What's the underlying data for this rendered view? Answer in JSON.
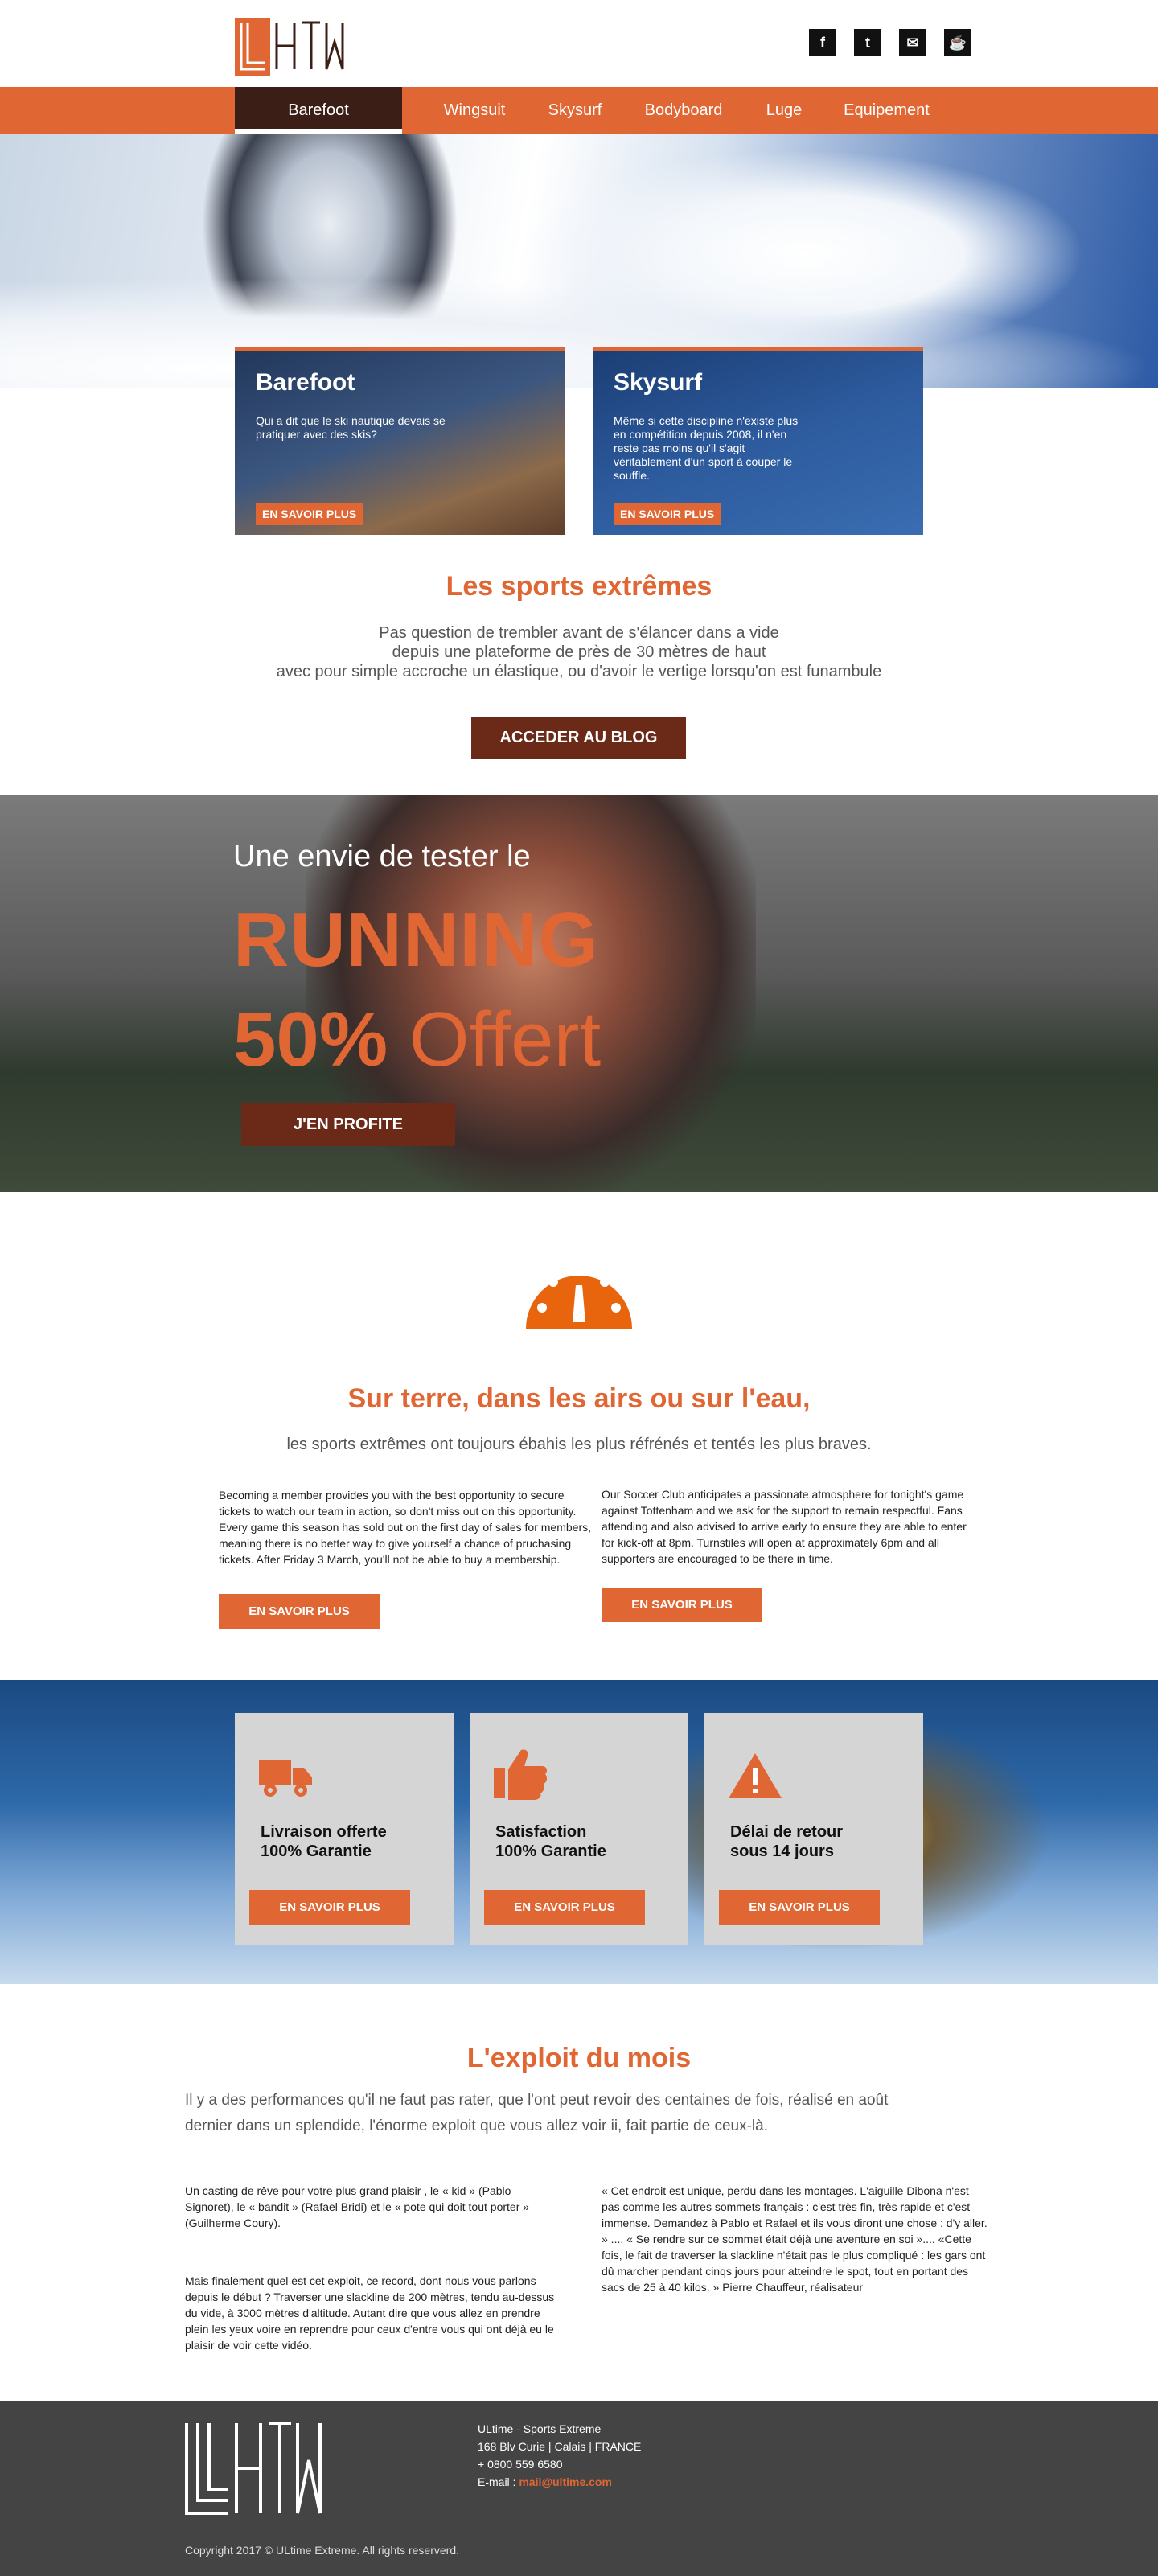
{
  "header": {
    "logo_label": "ULtime",
    "social": [
      {
        "icon": "facebook-icon",
        "glyph": "f"
      },
      {
        "icon": "twitter-icon",
        "glyph": "t"
      },
      {
        "icon": "mail-icon",
        "glyph": "✉"
      },
      {
        "icon": "coffee-icon",
        "glyph": "☕"
      }
    ]
  },
  "nav": {
    "items": [
      "Barefoot",
      "Wingsuit",
      "Skysurf",
      "Bodyboard",
      "Luge",
      "Equipement"
    ],
    "active": "Barefoot"
  },
  "cards": [
    {
      "title": "Barefoot",
      "text": "Qui a dit que le ski nautique devais se pratiquer avec des skis?",
      "button": "EN SAVOIR PLUS"
    },
    {
      "title": "Skysurf",
      "text": "Même si cette discipline n'existe plus en compétition depuis 2008, il n'en reste pas moins qu'il s'agit véritablement d'un sport à couper le souffle.",
      "button": "EN SAVOIR PLUS"
    }
  ],
  "sports": {
    "title": "Les sports extrêmes",
    "line1": "Pas question de trembler avant de s'élancer dans a vide",
    "line2": "depuis une plateforme de près de 30 mètres de haut",
    "line3": "avec pour simple accroche un élastique, ou d'avoir le vertige lorsqu'on est funambule",
    "button": "ACCEDER AU BLOG"
  },
  "promo": {
    "line1": "Une envie de tester le",
    "line2": "RUNNING",
    "percent": "50%",
    "offer": "Offert",
    "button": "J'EN PROFITE"
  },
  "terre": {
    "title": "Sur terre, dans les airs ou sur l'eau,",
    "subtitle": "les sports extrêmes ont toujours ébahis les plus réfrénés et tentés les plus braves.",
    "col1": "Becoming a member provides you with the best opportunity to secure tickets to watch our team in action, so don't miss out on this opportunity. Every game this season has sold out on the first day of sales for members, meaning there is no better way to give yourself a chance of pruchasing tickets. After Friday 3 March, you'll not be able to buy a membership.",
    "col2": "Our Soccer Club anticipates a passionate atmosphere for tonight's game against Tottenham and we ask for the support to remain respectful. Fans attending and also advised to arrive early to ensure they are able to enter for kick-off at 8pm. Turnstiles will open at approximately 6pm and all supporters are encouraged to be there in time.",
    "button": "EN SAVOIR PLUS"
  },
  "features": [
    {
      "icon": "truck-icon",
      "line1": "Livraison offerte",
      "line2": "100% Garantie",
      "button": "EN SAVOIR PLUS"
    },
    {
      "icon": "thumbs-up-icon",
      "line1": "Satisfaction",
      "line2": "100% Garantie",
      "button": "EN SAVOIR PLUS"
    },
    {
      "icon": "warning-icon",
      "line1": "Délai de retour",
      "line2": "sous 14 jours",
      "button": "EN SAVOIR PLUS"
    }
  ],
  "exploit": {
    "title": "L'exploit du mois",
    "intro1": "Il y a des performances qu'il ne faut pas rater, que l'ont peut revoir des centaines de fois, réalisé en août",
    "intro2": "dernier dans un splendide, l'énorme exploit que vous allez voir ii, fait partie de ceux-là.",
    "p1": "Un casting de rêve pour votre plus grand plaisir , le « kid » (Pablo Signoret), le « bandit » (Rafael Bridi) et le « pote qui doit tout porter » (Guilherme Coury).",
    "p2": "Mais finalement quel est cet exploit, ce record, dont nous vous parlons depuis le début ? Traverser une slackline de 200 mètres, tendu au-dessus du vide, à 3000 mètres d'altitude. Autant dire que vous allez en prendre plein les yeux voire en reprendre pour ceux d'entre vous qui ont déjà eu le plaisir de voir cette vidéo.",
    "p3": "« Cet endroit est unique, perdu dans les montages. L'aiguille Dibona n'est pas comme les autres sommets français : c'est très fin, très rapide et c'est immense. Demandez à Pablo et Rafael et ils vous diront une chose : d'y aller. » .... « Se rendre sur ce sommet était déjà une aventure en soi ».... «Cette fois, le fait de traverser la slackline n'était pas le plus compliqué : les gars ont dû marcher pendant cinqs jours pour atteindre le spot, tout en portant des sacs de 25 à 40 kilos. » Pierre Chauffeur, réalisateur"
  },
  "footer": {
    "company": "ULtime - Sports Extreme",
    "address": "168 Blv Curie | Calais | FRANCE",
    "phone": "+ 0800 559 6580",
    "email_label": "E-mail :",
    "email": "mail@ultime.com",
    "copyright": "Copyright 2017 © ULtime Extreme. All rights reserverd."
  },
  "colors": {
    "accent": "#e06633",
    "dark_button": "#6b2a17",
    "footer_bg": "#444444",
    "nav_active": "#3b1f16"
  }
}
